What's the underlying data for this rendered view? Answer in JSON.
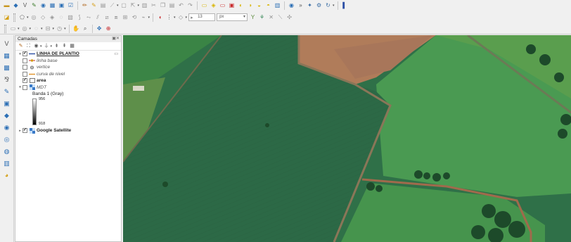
{
  "toolbar_top": {
    "icons": [
      "open-project-icon",
      "new-project-icon",
      "digitize-icon",
      "edit-icon",
      "save-icon",
      "save-as-icon",
      "print-layout-icon",
      "layout-manager-icon",
      "pencil-icon",
      "edit-toggle-icon",
      "add-feature-icon",
      "vertex-tool-icon",
      "move-feature-icon",
      "delete-icon",
      "cut-icon",
      "copy-icon",
      "paste-icon",
      "undo-icon",
      "redo-icon",
      "label-icon",
      "label-pin-icon",
      "label-show-icon",
      "label-move-icon",
      "label-rotate-icon",
      "label-change-icon",
      "label-hide-icon",
      "database-icon",
      "identify-icon",
      "python-icon",
      "plugin-icon",
      "refresh-icon",
      "help-icon"
    ]
  },
  "toolbar_mid": {
    "width_value": "13",
    "unit_select": "px"
  },
  "layers": {
    "title": "Camadas",
    "items": [
      {
        "label": "LINHA DE PLANTIO",
        "checked": true,
        "style": "bold underline",
        "symbol": "line",
        "expander": "▾"
      },
      {
        "label": "linha base",
        "checked": false,
        "style": "italic",
        "symbol": "line-vertex",
        "expander": ""
      },
      {
        "label": "vertice",
        "checked": false,
        "style": "italic",
        "symbol": "point",
        "expander": ""
      },
      {
        "label": "curva de nivel",
        "checked": false,
        "style": "italic",
        "symbol": "line-orange",
        "expander": ""
      },
      {
        "label": "area",
        "checked": true,
        "style": "bold",
        "symbol": "polygon",
        "expander": ""
      },
      {
        "label": "MDT",
        "checked": false,
        "style": "italic",
        "symbol": "raster",
        "expander": "▾"
      },
      {
        "label": "Banda 1 (Gray)",
        "checked": false,
        "style": "plain",
        "symbol": "",
        "expander": ""
      },
      {
        "label": "Google Satellite",
        "checked": true,
        "style": "bold",
        "symbol": "raster",
        "expander": "▸"
      }
    ],
    "legend_max": "956",
    "legend_min": "918"
  }
}
